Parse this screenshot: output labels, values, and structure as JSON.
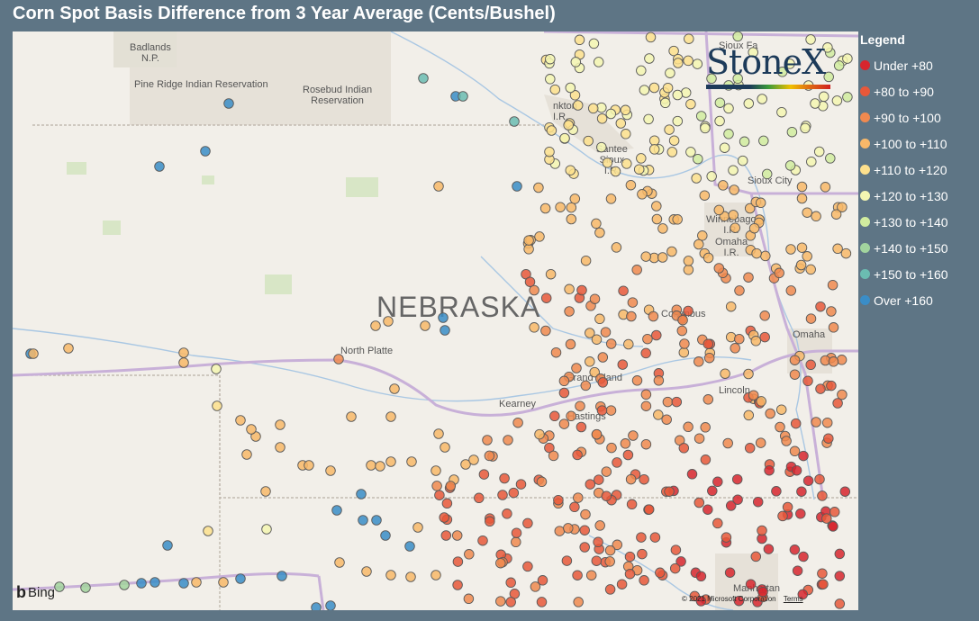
{
  "title": "Corn Spot Basis Difference from 3 Year Average (Cents/Bushel)",
  "legend": {
    "title": "Legend",
    "items": [
      {
        "label": "Under +80",
        "color": "#d7262e"
      },
      {
        "label": "+80 to +90",
        "color": "#e8583a"
      },
      {
        "label": "+90 to +100",
        "color": "#f0894f"
      },
      {
        "label": "+100 to +110",
        "color": "#f8b869"
      },
      {
        "label": "+110 to +120",
        "color": "#fde08d"
      },
      {
        "label": "+120 to +130",
        "color": "#f4f6b2"
      },
      {
        "label": "+130 to +140",
        "color": "#d1ec9f"
      },
      {
        "label": "+140 to +150",
        "color": "#a2d49e"
      },
      {
        "label": "+150 to +160",
        "color": "#6bbcb1"
      },
      {
        "label": "Over +160",
        "color": "#3a8dc7"
      }
    ]
  },
  "logo": {
    "text": "StoneX"
  },
  "attribution": {
    "provider": "Bing",
    "copyright": "© 2021 Microsoft Corporation",
    "terms": "Terms"
  },
  "places": {
    "state": "NEBRASKA",
    "badlands": "Badlands\nN.P.",
    "pine_ridge": "Pine Ridge Indian Reservation",
    "rosebud": "Rosebud Indian\nReservation",
    "yankton": "nkton\nI.R.",
    "santee": "Santee\nSioux\nI.R.",
    "sioux_falls": "Sioux Fa",
    "sioux_city": "Sioux City",
    "winnebago": "Winnebago\nI.R.",
    "omaha_ir": "Omaha\nI.R.",
    "columbus": "Columbus",
    "north_platte": "North Platte",
    "grand_island": "Grand Island",
    "kearney": "Kearney",
    "hastings": "Hastings",
    "lincoln": "Lincoln",
    "omaha": "Omaha",
    "manhattan": "Manhattan"
  }
}
